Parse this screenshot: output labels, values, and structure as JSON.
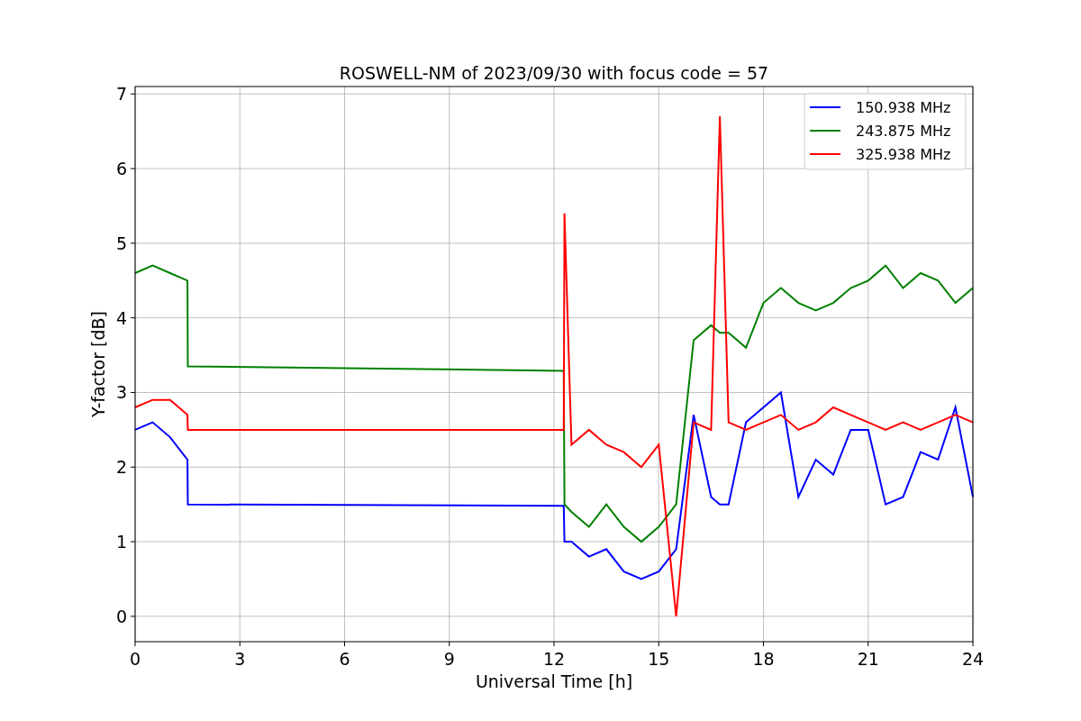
{
  "chart_data": {
    "type": "line",
    "title": "ROSWELL-NM of 2023/09/30 with focus code = 57",
    "xlabel": "Universal Time [h]",
    "ylabel": "Y-factor [dB]",
    "x": [
      0,
      0.5,
      1.0,
      1.5,
      1.51,
      12.28,
      12.3,
      12.5,
      13,
      13.5,
      14,
      14.5,
      15,
      15.5,
      16,
      16.5,
      16.75,
      17,
      17.5,
      18,
      18.5,
      19,
      19.5,
      20,
      20.5,
      21,
      21.5,
      22,
      22.5,
      23,
      23.5,
      24
    ],
    "series": [
      {
        "name": "150.938 MHz",
        "color": "#0000ff",
        "values": [
          2.5,
          2.6,
          2.4,
          2.1,
          1.5,
          1.48,
          1.0,
          1.0,
          0.8,
          0.9,
          0.6,
          0.5,
          0.6,
          0.9,
          2.7,
          1.6,
          1.5,
          1.5,
          2.6,
          2.8,
          3.0,
          1.6,
          2.1,
          1.9,
          2.5,
          2.5,
          1.5,
          1.6,
          2.2,
          2.1,
          2.8,
          1.6
        ]
      },
      {
        "name": "243.875 MHz",
        "color": "#008000",
        "values": [
          4.6,
          4.7,
          4.6,
          4.5,
          3.35,
          3.29,
          1.5,
          1.4,
          1.2,
          1.5,
          1.2,
          1.0,
          1.2,
          1.5,
          3.7,
          3.9,
          3.8,
          3.8,
          3.6,
          4.2,
          4.4,
          4.2,
          4.1,
          4.2,
          4.4,
          4.5,
          4.7,
          4.4,
          4.6,
          4.5,
          4.2,
          4.4
        ]
      },
      {
        "name": "325.938 MHz",
        "color": "#ff0000",
        "values": [
          2.8,
          2.9,
          2.9,
          2.7,
          2.5,
          2.5,
          5.4,
          2.3,
          2.5,
          2.3,
          2.2,
          2.0,
          2.3,
          0.0,
          2.6,
          2.5,
          6.7,
          2.6,
          2.5,
          2.6,
          2.7,
          2.5,
          2.6,
          2.8,
          2.7,
          2.6,
          2.5,
          2.6,
          2.5,
          2.6,
          2.7,
          2.6
        ]
      }
    ],
    "grid": true,
    "legend": true,
    "xlim": [
      0,
      24
    ],
    "ylim": [
      -0.34,
      7.1
    ],
    "xticks": [
      0,
      3,
      6,
      9,
      12,
      15,
      18,
      21,
      24
    ],
    "yticks": [
      0,
      1,
      2,
      3,
      4,
      5,
      6,
      7
    ]
  }
}
